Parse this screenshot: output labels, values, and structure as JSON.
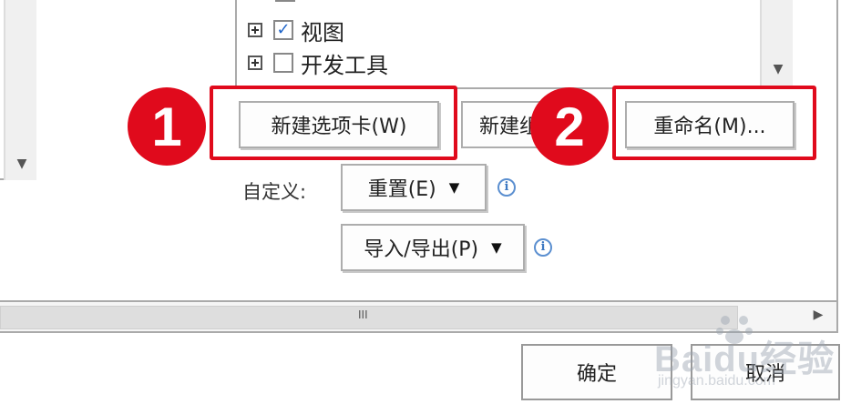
{
  "tree": {
    "items": [
      {
        "label": "视图",
        "checked": true,
        "check_mark": "✓"
      },
      {
        "label": "开发工具",
        "checked": false,
        "check_mark": ""
      }
    ]
  },
  "buttons": {
    "new_tab": "新建选项卡(W)",
    "new_group": "新建组(N)",
    "rename": "重命名(M)...",
    "reset": "重置(E)",
    "import_export": "导入/导出(P)",
    "ok": "确定",
    "cancel": "取消"
  },
  "customize_label": "自定义:",
  "callouts": {
    "first": "1",
    "second": "2"
  },
  "scroll": {
    "thumb_grip": "III"
  },
  "watermark": {
    "brand": "Baidu经验",
    "url": "jingyan.baidu.com"
  },
  "colors": {
    "callout_red": "#e00a1c",
    "check_blue": "#1e64c8",
    "info_blue": "#3d78c2"
  }
}
